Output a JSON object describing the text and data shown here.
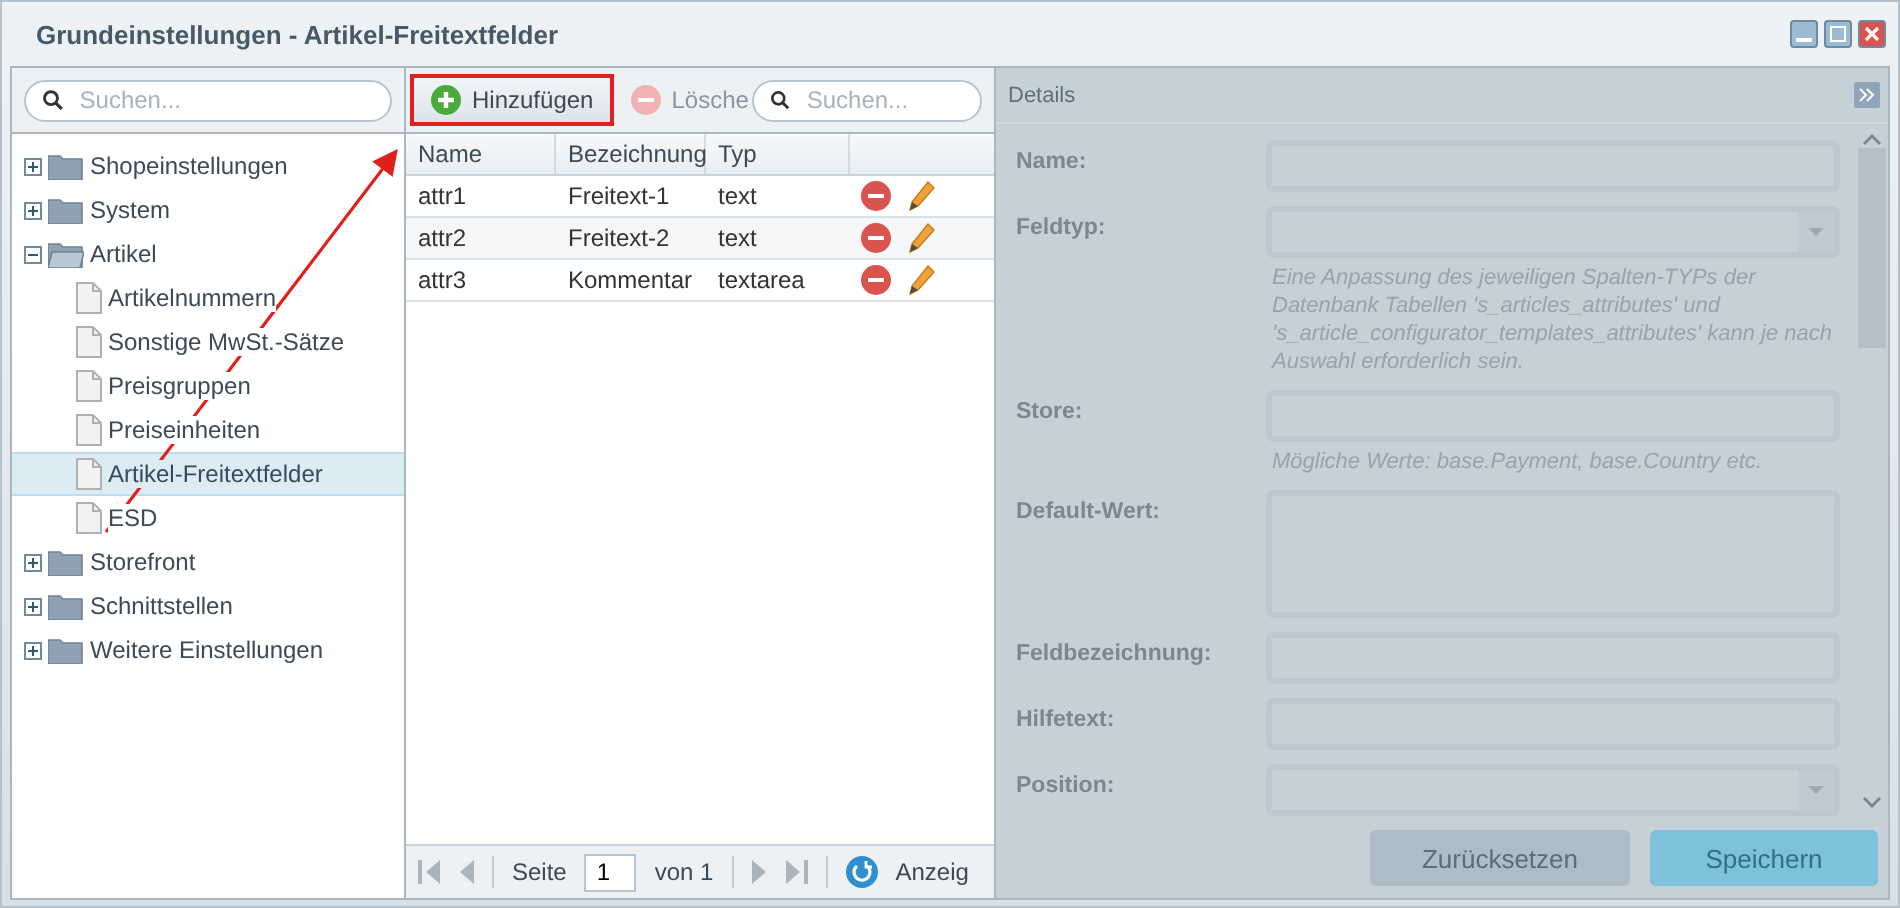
{
  "window": {
    "title": "Grundeinstellungen - Artikel-Freitextfelder"
  },
  "tree": {
    "search": {
      "placeholder": "Suchen..."
    },
    "items": [
      {
        "label": "Shopeinstellungen",
        "kind": "folder",
        "expanded": false,
        "selected": false
      },
      {
        "label": "System",
        "kind": "folder",
        "expanded": false,
        "selected": false
      },
      {
        "label": "Artikel",
        "kind": "folder",
        "expanded": true,
        "selected": false,
        "children": [
          {
            "label": "Artikelnummern",
            "kind": "leaf",
            "selected": false
          },
          {
            "label": "Sonstige MwSt.-Sätze",
            "kind": "leaf",
            "selected": false
          },
          {
            "label": "Preisgruppen",
            "kind": "leaf",
            "selected": false
          },
          {
            "label": "Preiseinheiten",
            "kind": "leaf",
            "selected": false
          },
          {
            "label": "Artikel-Freitextfelder",
            "kind": "leaf",
            "selected": true
          },
          {
            "label": "ESD",
            "kind": "leaf",
            "selected": false
          }
        ]
      },
      {
        "label": "Storefront",
        "kind": "folder",
        "expanded": false,
        "selected": false
      },
      {
        "label": "Schnittstellen",
        "kind": "folder",
        "expanded": false,
        "selected": false
      },
      {
        "label": "Weitere Einstellungen",
        "kind": "folder",
        "expanded": false,
        "selected": false
      }
    ]
  },
  "grid": {
    "toolbar": {
      "add": {
        "label": "Hinzufügen",
        "highlighted": true
      },
      "delete": {
        "label": "Lösche",
        "disabled": true
      },
      "search": {
        "placeholder": "Suchen..."
      }
    },
    "columns": [
      "Name",
      "Bezeichnung",
      "Typ"
    ],
    "rows": [
      {
        "cells": [
          "attr1",
          "Freitext-1",
          "text"
        ]
      },
      {
        "cells": [
          "attr2",
          "Freitext-2",
          "text"
        ]
      },
      {
        "cells": [
          "attr3",
          "Kommentar",
          "textarea"
        ]
      }
    ],
    "pager": {
      "page_label": "Seite",
      "page": "1",
      "of": "von 1",
      "display": "Anzeig"
    }
  },
  "annotation_arrow": true,
  "details": {
    "title": "Details",
    "disabled": true,
    "fields": [
      {
        "label": "Name:",
        "kind": "text"
      },
      {
        "label": "Feldtyp:",
        "kind": "select",
        "hint": "Eine Anpassung des jeweiligen Spalten-TYPs der Datenbank Tabellen 's_articles_attributes' und 's_article_configurator_templates_attributes' kann je nach Auswahl erforderlich sein."
      },
      {
        "label": "Store:",
        "kind": "text",
        "hint": "Mögliche Werte: base.Payment, base.Country etc."
      },
      {
        "label": "Default-Wert:",
        "kind": "textarea"
      },
      {
        "label": "Feldbezeichnung:",
        "kind": "text"
      },
      {
        "label": "Hilfetext:",
        "kind": "text"
      },
      {
        "label": "Position:",
        "kind": "number"
      }
    ],
    "buttons": [
      {
        "label": "Zurücksetzen",
        "kind": "secondary"
      },
      {
        "label": "Speichern",
        "kind": "primary"
      }
    ]
  }
}
